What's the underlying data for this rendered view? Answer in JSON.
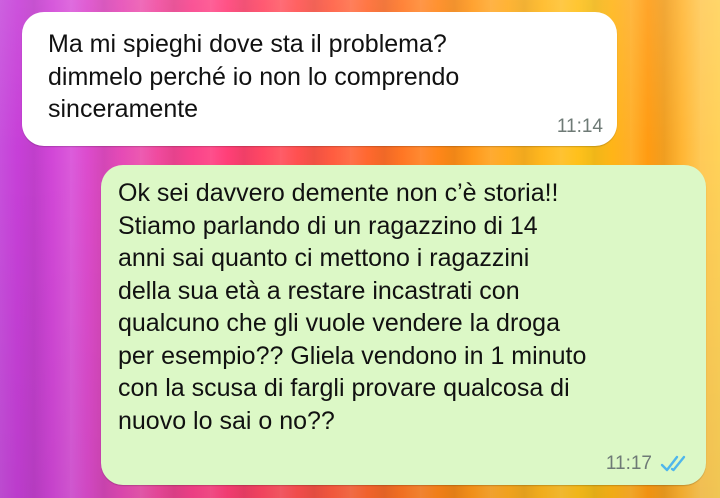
{
  "chat": {
    "messages": [
      {
        "direction": "incoming",
        "text": "Ma mi spieghi dove sta il problema?\ndimmelo perché io non lo comprendo\nsinceramente",
        "time": "11:14"
      },
      {
        "direction": "outgoing",
        "text": "Ok sei davvero demente non c’è storia!!\nStiamo parlando di un ragazzino di 14\nanni sai quanto ci mettono i ragazzini\ndella sua età a restare incastrati con\nqualcuno che gli vuole vendere la droga\nper esempio?? Gliela vendono in 1 minuto\ncon la scusa di fargli provare qualcosa di\nnuovo lo sai o no??",
        "time": "11:17",
        "status_icon": "double-check-read-icon"
      }
    ]
  },
  "colors": {
    "incoming_bubble": "#ffffff",
    "outgoing_bubble": "#dcf8c6",
    "timestamp": "#6e7a76",
    "read_ticks": "#4fb6ec"
  }
}
